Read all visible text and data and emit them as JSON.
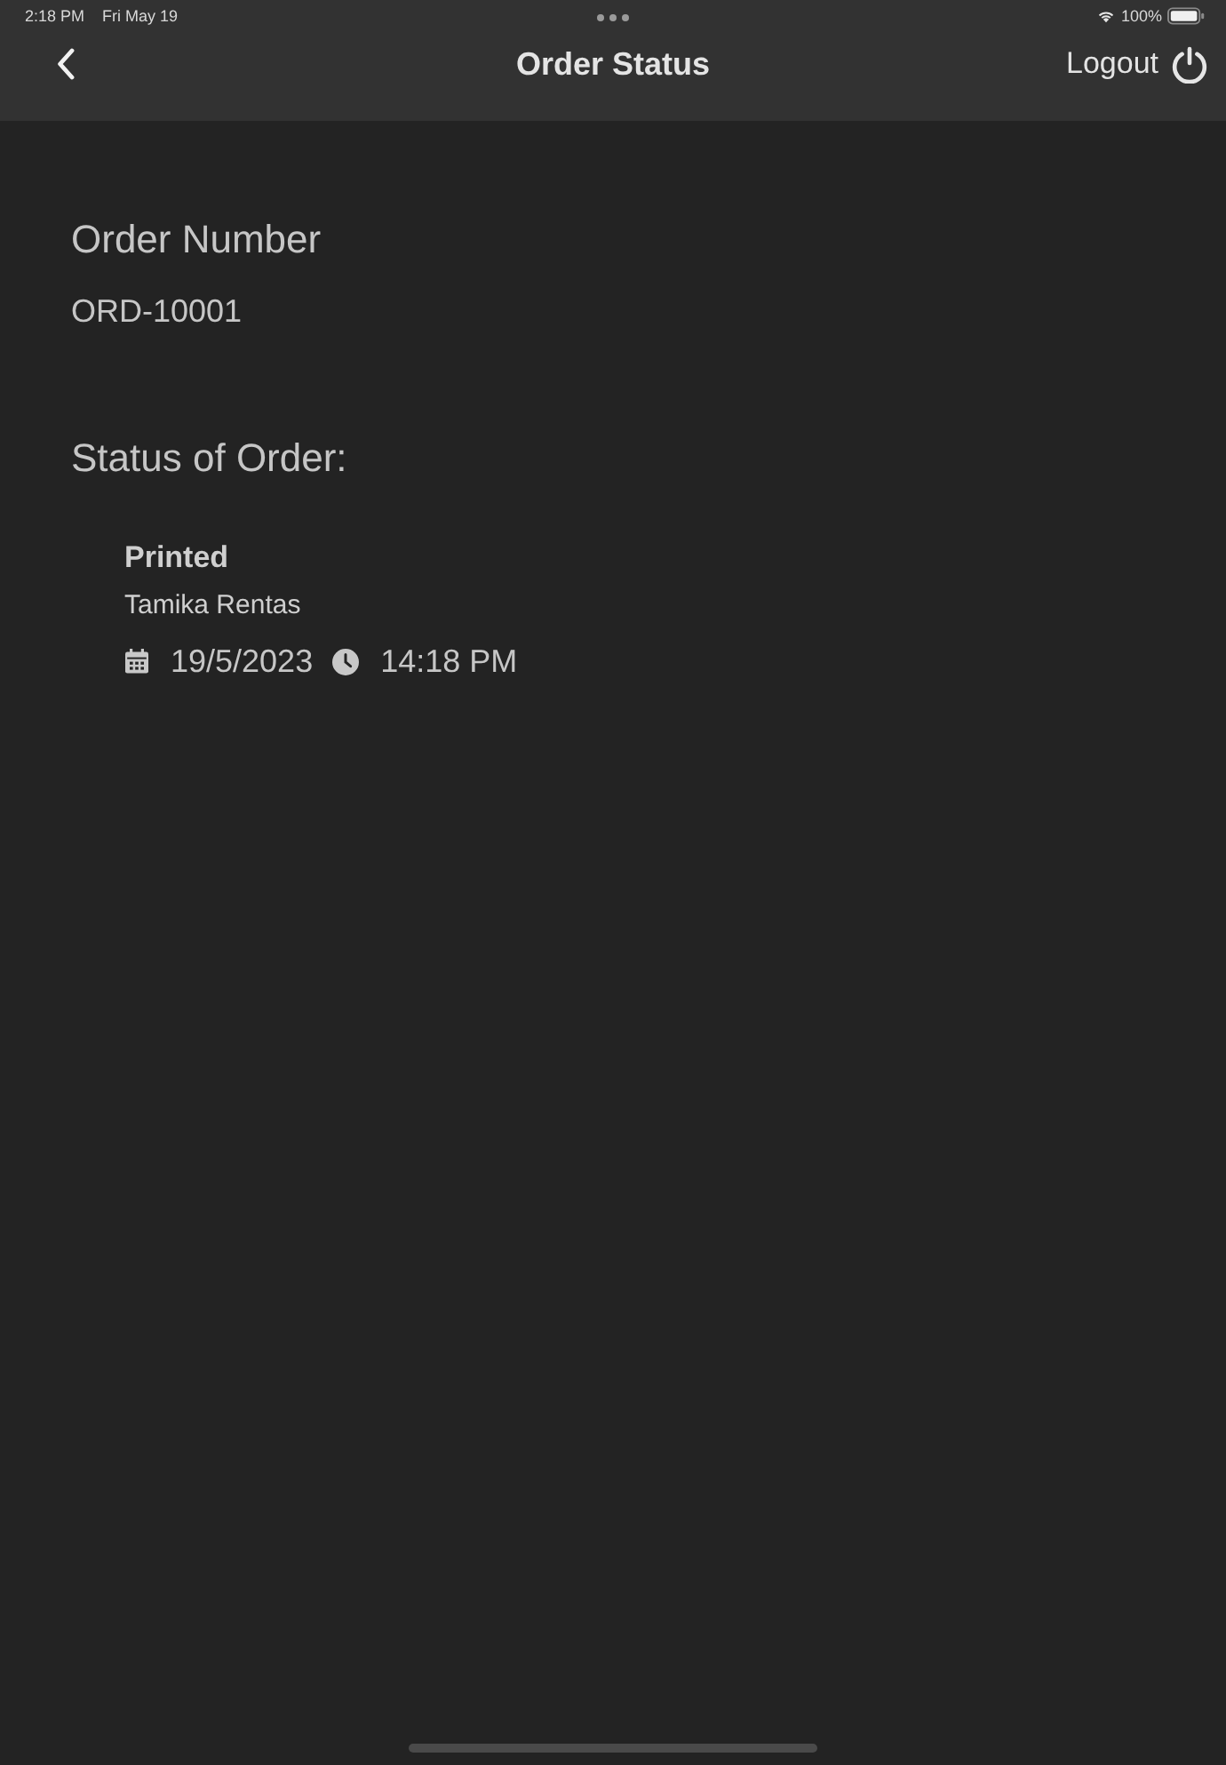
{
  "status_bar": {
    "time": "2:18 PM",
    "date": "Fri May 19",
    "battery": "100%"
  },
  "nav_bar": {
    "title": "Order Status",
    "logout_label": "Logout"
  },
  "order": {
    "number_label": "Order Number",
    "number": "ORD-10001"
  },
  "status_section": {
    "heading": "Status of Order:",
    "entries": [
      {
        "status": "Printed",
        "user": "Tamika Rentas",
        "date": "19/5/2023",
        "time": "14:18 PM"
      }
    ]
  }
}
